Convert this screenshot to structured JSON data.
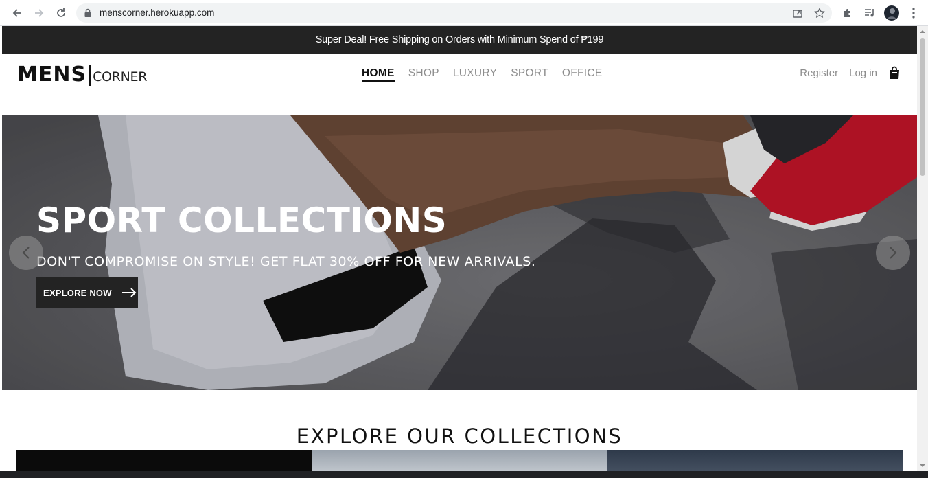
{
  "browser": {
    "url": "menscorner.herokuapp.com"
  },
  "promo": {
    "text": "Super Deal! Free Shipping on Orders with Minimum Spend of ₱199"
  },
  "logo": {
    "bold": "MENS",
    "light": "CORNER"
  },
  "nav": {
    "items": [
      {
        "label": "HOME",
        "active": true
      },
      {
        "label": "SHOP",
        "active": false
      },
      {
        "label": "LUXURY",
        "active": false
      },
      {
        "label": "SPORT",
        "active": false
      },
      {
        "label": "OFFICE",
        "active": false
      }
    ]
  },
  "account": {
    "register": "Register",
    "login": "Log in",
    "cart_icon": "shopping-bag-icon"
  },
  "hero": {
    "title": "SPORT COLLECTIONS",
    "subtitle": "DON'T COMPROMISE ON STYLE! GET FLAT 30% OFF FOR NEW ARRIVALS.",
    "cta": "EXPLORE NOW",
    "prev_icon": "chevron-left-icon",
    "next_icon": "chevron-right-icon"
  },
  "collections": {
    "title": "EXPLORE OUR COLLECTIONS"
  },
  "colors": {
    "promo_bg": "#232323",
    "nav_inactive": "#8d8d8d",
    "text_dark": "#111111"
  }
}
